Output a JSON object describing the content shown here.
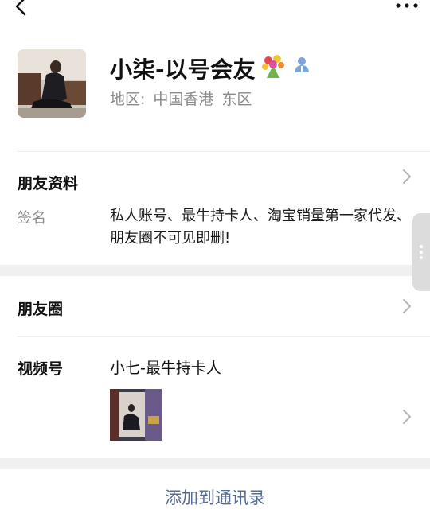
{
  "profile": {
    "name": "小柒-以号会友",
    "region_label": "地区:",
    "region_value_1": "中国香港",
    "region_value_2": "东区"
  },
  "friend_info": {
    "label": "朋友资料",
    "signature_label": "签名",
    "signature_text": "私人账号、最牛持卡人、淘宝销量第一家代发、朋友圈不可见即删!"
  },
  "moments": {
    "label": "朋友圈"
  },
  "channels": {
    "label": "视频号",
    "channel_name": "小七-最牛持卡人"
  },
  "actions": {
    "add_contact": "添加到通讯录"
  },
  "colors": {
    "link_blue": "#576b95",
    "secondary_text": "#8a8a8a",
    "section_gap": "#f0f0f0",
    "verified_icon": "#7fa4d8"
  },
  "icons": [
    "back-icon",
    "more-icon",
    "flower-emoji-icon",
    "person-icon",
    "chevron-right-icon"
  ]
}
